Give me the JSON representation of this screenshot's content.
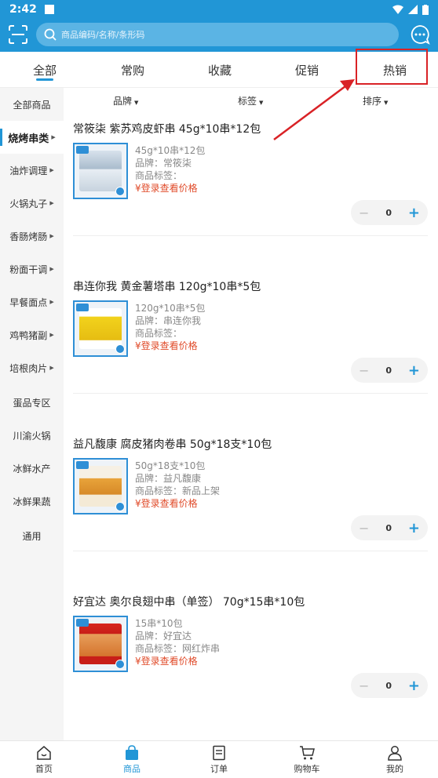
{
  "status_bar": {
    "time": "2:42"
  },
  "search": {
    "placeholder": "商品编码/名称/条形码"
  },
  "tabs": [
    {
      "label": "全部"
    },
    {
      "label": "常购"
    },
    {
      "label": "收藏"
    },
    {
      "label": "促销"
    },
    {
      "label": "热销"
    }
  ],
  "sidebar": {
    "items": [
      {
        "label": "全部商品"
      },
      {
        "label": "烧烤串类"
      },
      {
        "label": "油炸调理"
      },
      {
        "label": "火锅丸子"
      },
      {
        "label": "香肠烤肠"
      },
      {
        "label": "粉面干调"
      },
      {
        "label": "早餐面点"
      },
      {
        "label": "鸡鸭猪副"
      },
      {
        "label": "培根肉片"
      },
      {
        "label": "蛋品专区"
      },
      {
        "label": "川渝火锅"
      },
      {
        "label": "冰鲜水产"
      },
      {
        "label": "冰鲜果蔬"
      },
      {
        "label": "通用"
      }
    ]
  },
  "filters": {
    "brand": "品牌",
    "tag": "标签",
    "sort": "排序"
  },
  "products": [
    {
      "title": "常筱柒 紫苏鸡皮虾串 45g*10串*12包",
      "spec": "45g*10串*12包",
      "brand": "品牌：常筱柒",
      "tag": "商品标签：",
      "price": "¥登录查看价格",
      "qty": "0"
    },
    {
      "title": "串连你我 黄金薯塔串 120g*10串*5包",
      "spec": "120g*10串*5包",
      "brand": "品牌：串连你我",
      "tag": "商品标签：",
      "price": "¥登录查看价格",
      "qty": "0"
    },
    {
      "title": "益凡馥康 腐皮猪肉卷串 50g*18支*10包",
      "spec": "50g*18支*10包",
      "brand": "品牌：益凡馥康",
      "tag": "商品标签：新品上架",
      "price": "¥登录查看价格",
      "qty": "0"
    },
    {
      "title": "好宜达 奥尔良翅中串（单签） 70g*15串*10包",
      "spec": "15串*10包",
      "brand": "品牌：好宜达",
      "tag": "商品标签：网红炸串",
      "price": "¥登录查看价格",
      "qty": "0"
    }
  ],
  "bottom_nav": [
    {
      "label": "首页"
    },
    {
      "label": "商品"
    },
    {
      "label": "订单"
    },
    {
      "label": "购物车"
    },
    {
      "label": "我的"
    }
  ],
  "colors": {
    "primary": "#2196d6",
    "price": "#e04b2a",
    "annotation": "#d92226"
  },
  "icons": [
    "scan-icon",
    "search-icon",
    "chat-icon",
    "home-icon",
    "bag-icon",
    "order-icon",
    "cart-icon",
    "user-icon"
  ]
}
